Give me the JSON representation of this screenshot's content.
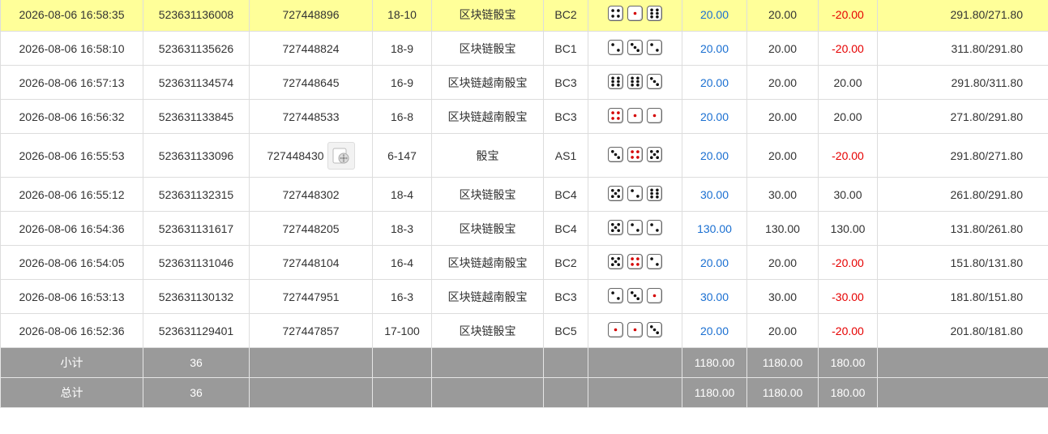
{
  "colors": {
    "highlight": "#ffff99",
    "bet": "#1a6fd1",
    "negative": "#e60000",
    "summary_bg": "#9a9a9a"
  },
  "rows": [
    {
      "time": "2026-08-06 16:58:35",
      "order": "523631136008",
      "issue": "727448896",
      "table": "18-10",
      "game": "区块链骰宝",
      "room": "BC2",
      "dice": [
        {
          "v": 4,
          "red": false
        },
        {
          "v": 1,
          "red": true
        },
        {
          "v": 6,
          "red": false
        }
      ],
      "bet": "20.00",
      "valid": "20.00",
      "win": "-20.00",
      "balance": "291.80/271.80",
      "highlight": true
    },
    {
      "time": "2026-08-06 16:58:10",
      "order": "523631135626",
      "issue": "727448824",
      "table": "18-9",
      "game": "区块链骰宝",
      "room": "BC1",
      "dice": [
        {
          "v": 2,
          "red": false
        },
        {
          "v": 3,
          "red": false
        },
        {
          "v": 2,
          "red": false
        }
      ],
      "bet": "20.00",
      "valid": "20.00",
      "win": "-20.00",
      "balance": "311.80/291.80"
    },
    {
      "time": "2026-08-06 16:57:13",
      "order": "523631134574",
      "issue": "727448645",
      "table": "16-9",
      "game": "区块链越南骰宝",
      "room": "BC3",
      "dice": [
        {
          "v": 6,
          "red": false
        },
        {
          "v": 6,
          "red": false
        },
        {
          "v": 3,
          "red": false
        }
      ],
      "bet": "20.00",
      "valid": "20.00",
      "win": "20.00",
      "balance": "291.80/311.80"
    },
    {
      "time": "2026-08-06 16:56:32",
      "order": "523631133845",
      "issue": "727448533",
      "table": "16-8",
      "game": "区块链越南骰宝",
      "room": "BC3",
      "dice": [
        {
          "v": 4,
          "red": true
        },
        {
          "v": 1,
          "red": true
        },
        {
          "v": 1,
          "red": true
        }
      ],
      "bet": "20.00",
      "valid": "20.00",
      "win": "20.00",
      "balance": "271.80/291.80"
    },
    {
      "time": "2026-08-06 16:55:53",
      "order": "523631133096",
      "issue": "727448430",
      "table": "6-147",
      "game": "骰宝",
      "room": "AS1",
      "dice": [
        {
          "v": 3,
          "red": false
        },
        {
          "v": 4,
          "red": true
        },
        {
          "v": 5,
          "red": false
        }
      ],
      "bet": "20.00",
      "valid": "20.00",
      "win": "-20.00",
      "balance": "291.80/271.80",
      "tall": true,
      "video": true
    },
    {
      "time": "2026-08-06 16:55:12",
      "order": "523631132315",
      "issue": "727448302",
      "table": "18-4",
      "game": "区块链骰宝",
      "room": "BC4",
      "dice": [
        {
          "v": 5,
          "red": false
        },
        {
          "v": 2,
          "red": false
        },
        {
          "v": 6,
          "red": false
        }
      ],
      "bet": "30.00",
      "valid": "30.00",
      "win": "30.00",
      "balance": "261.80/291.80"
    },
    {
      "time": "2026-08-06 16:54:36",
      "order": "523631131617",
      "issue": "727448205",
      "table": "18-3",
      "game": "区块链骰宝",
      "room": "BC4",
      "dice": [
        {
          "v": 5,
          "red": false
        },
        {
          "v": 2,
          "red": false
        },
        {
          "v": 2,
          "red": false
        }
      ],
      "bet": "130.00",
      "valid": "130.00",
      "win": "130.00",
      "balance": "131.80/261.80"
    },
    {
      "time": "2026-08-06 16:54:05",
      "order": "523631131046",
      "issue": "727448104",
      "table": "16-4",
      "game": "区块链越南骰宝",
      "room": "BC2",
      "dice": [
        {
          "v": 5,
          "red": false
        },
        {
          "v": 4,
          "red": true
        },
        {
          "v": 2,
          "red": false
        }
      ],
      "bet": "20.00",
      "valid": "20.00",
      "win": "-20.00",
      "balance": "151.80/131.80"
    },
    {
      "time": "2026-08-06 16:53:13",
      "order": "523631130132",
      "issue": "727447951",
      "table": "16-3",
      "game": "区块链越南骰宝",
      "room": "BC3",
      "dice": [
        {
          "v": 2,
          "red": false
        },
        {
          "v": 3,
          "red": false
        },
        {
          "v": 1,
          "red": true
        }
      ],
      "bet": "30.00",
      "valid": "30.00",
      "win": "-30.00",
      "balance": "181.80/151.80"
    },
    {
      "time": "2026-08-06 16:52:36",
      "order": "523631129401",
      "issue": "727447857",
      "table": "17-100",
      "game": "区块链骰宝",
      "room": "BC5",
      "dice": [
        {
          "v": 1,
          "red": true
        },
        {
          "v": 1,
          "red": true
        },
        {
          "v": 3,
          "red": false
        }
      ],
      "bet": "20.00",
      "valid": "20.00",
      "win": "-20.00",
      "balance": "201.80/181.80"
    }
  ],
  "summary": [
    {
      "label": "小计",
      "count": "36",
      "bet": "1180.00",
      "valid": "1180.00",
      "win": "180.00"
    },
    {
      "label": "总计",
      "count": "36",
      "bet": "1180.00",
      "valid": "1180.00",
      "win": "180.00"
    }
  ]
}
